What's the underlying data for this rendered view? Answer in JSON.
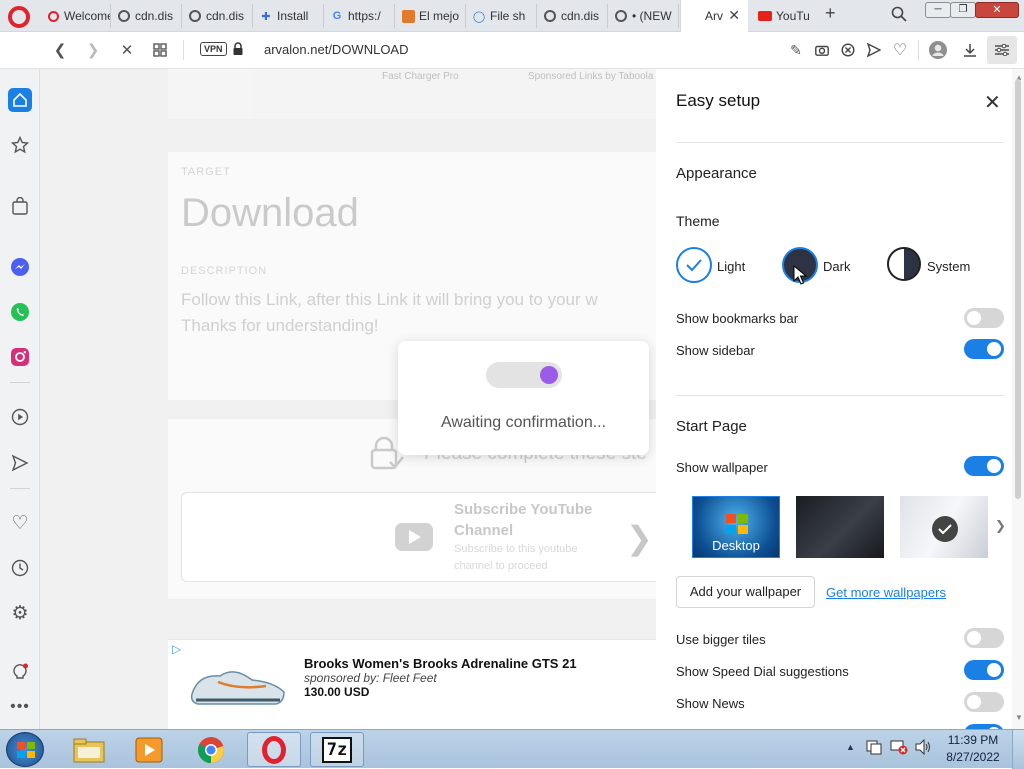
{
  "tabs": [
    {
      "label": "Welcome",
      "icon": "opera-icon"
    },
    {
      "label": "cdn.dis",
      "icon": "globe-icon"
    },
    {
      "label": "cdn.dis",
      "icon": "globe-icon"
    },
    {
      "label": "Install",
      "icon": "install-icon"
    },
    {
      "label": "https:/",
      "icon": "google-icon"
    },
    {
      "label": "El mejo",
      "icon": "image-icon"
    },
    {
      "label": "File sh",
      "icon": "file-share-icon"
    },
    {
      "label": "cdn.dis",
      "icon": "globe-icon"
    },
    {
      "label": "• (NEW",
      "icon": "globe-icon"
    },
    {
      "label": "Arv",
      "icon": "none"
    },
    {
      "label": "YouTu",
      "icon": "youtube-icon"
    }
  ],
  "address": {
    "vpn": "VPN",
    "url": "arvalon.net/DOWNLOAD"
  },
  "page": {
    "top_left": "Fast Charger Pro",
    "top_right": "Sponsored Links by Taboola",
    "target_label": "TARGET",
    "title": "Download",
    "desc_label": "DESCRIPTION",
    "desc_line1": "Follow this Link, after this Link it will bring you to your w",
    "desc_line2": "Thanks for understanding!",
    "complete_text": "Please complete these ste",
    "step_title1": "Subscribe YouTube",
    "step_title2": "Channel",
    "step_sub1": "Subscribe to this youtube",
    "step_sub2": "channel to proceed",
    "ad_title": "Brooks Women's Brooks Adrenaline GTS 21",
    "ad_sponsor_prefix": "sponsored by: ",
    "ad_sponsor": "Fleet Feet",
    "ad_price": "130.00 USD"
  },
  "popup": {
    "text": "Awaiting confirmation..."
  },
  "setup": {
    "title": "Easy setup",
    "appearance": "Appearance",
    "theme": "Theme",
    "theme_light": "Light",
    "theme_dark": "Dark",
    "theme_system": "System",
    "selected_theme": "Light",
    "bookmarks": "Show bookmarks bar",
    "sidebar": "Show sidebar",
    "start_page": "Start Page",
    "wallpaper": "Show wallpaper",
    "wp_desktop": "Desktop",
    "add_wallpaper": "Add your wallpaper",
    "more_wallpapers": "Get more wallpapers",
    "bigger_tiles": "Use bigger tiles",
    "speed_dial": "Show Speed Dial suggestions",
    "news": "Show News",
    "toggles": {
      "bookmarks": false,
      "sidebar": true,
      "wallpaper": true,
      "bigger_tiles": false,
      "speed_dial": true,
      "news": false
    }
  },
  "taskbar": {
    "time": "11:39 PM",
    "date": "8/27/2022"
  },
  "colors": {
    "accent": "#1b80e5",
    "opera_red": "#e0232c",
    "ad_purple": "#9b5de5"
  }
}
